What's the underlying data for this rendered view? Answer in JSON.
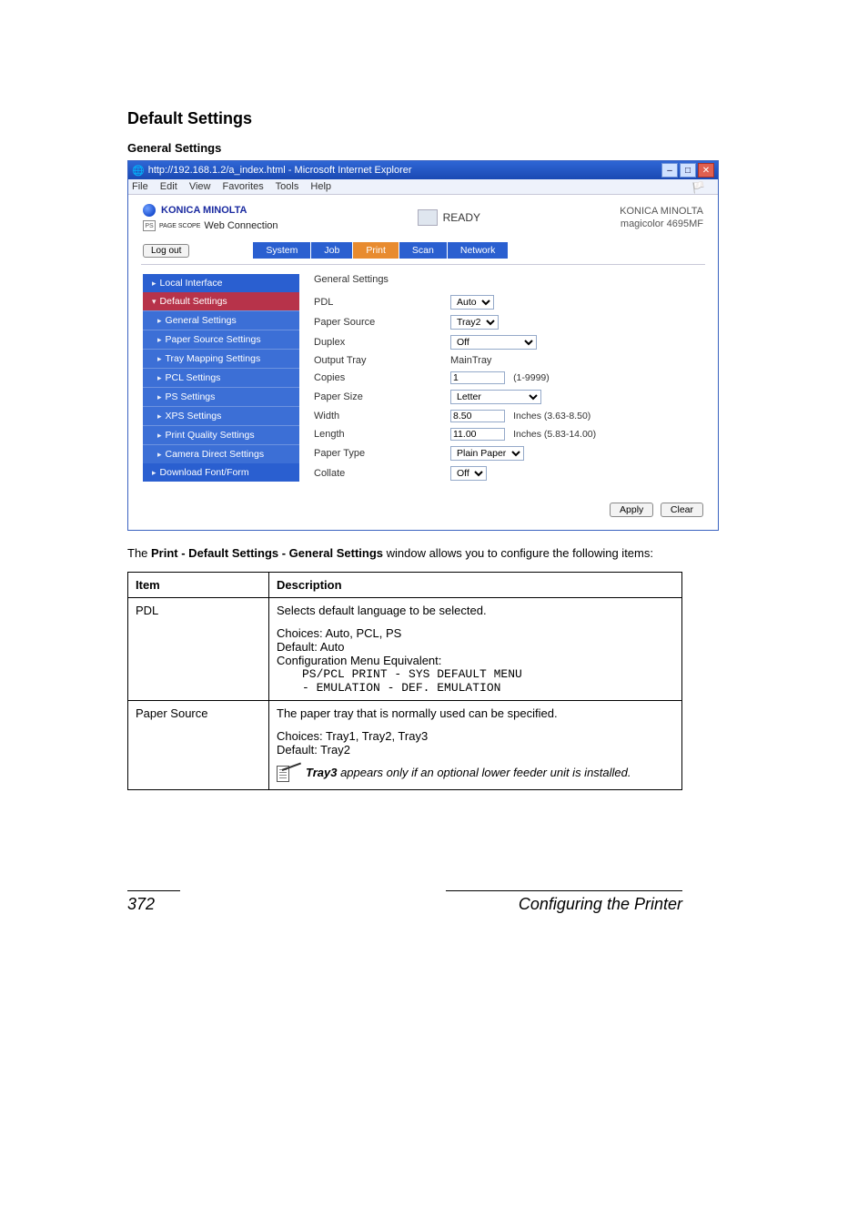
{
  "doc": {
    "section_title": "Default Settings",
    "subheading": "General Settings",
    "paragraph_prefix": "The ",
    "paragraph_bold": "Print - Default Settings - General Settings",
    "paragraph_suffix": " window allows you to configure the following items:",
    "footer_page": "372",
    "footer_text": "Configuring the Printer"
  },
  "win": {
    "title": "http://192.168.1.2/a_index.html - Microsoft Internet Explorer",
    "menu": {
      "file": "File",
      "edit": "Edit",
      "view": "View",
      "favorites": "Favorites",
      "tools": "Tools",
      "help": "Help"
    },
    "brand": "KONICA MINOLTA",
    "brand_sub": "Web Connection",
    "brand_sub_prefix": "PAGE SCOPE",
    "ready": "READY",
    "model_line1": "KONICA MINOLTA",
    "model_line2": "magicolor 4695MF",
    "logout": "Log out",
    "tabs": {
      "system": "System",
      "job": "Job",
      "print": "Print",
      "scan": "Scan",
      "network": "Network"
    }
  },
  "sidebar": {
    "local_interface": "Local Interface",
    "default_settings": "Default Settings",
    "general_settings": "General Settings",
    "paper_source_settings": "Paper Source Settings",
    "tray_mapping_settings": "Tray Mapping Settings",
    "pcl_settings": "PCL Settings",
    "ps_settings": "PS Settings",
    "xps_settings": "XPS Settings",
    "print_quality_settings": "Print Quality Settings",
    "camera_direct_settings": "Camera Direct Settings",
    "download_font_form": "Download Font/Form"
  },
  "form": {
    "title": "General Settings",
    "pdl": {
      "label": "PDL",
      "value": "Auto"
    },
    "paper_source": {
      "label": "Paper Source",
      "value": "Tray2"
    },
    "duplex": {
      "label": "Duplex",
      "value": "Off"
    },
    "output_tray": {
      "label": "Output Tray",
      "value": "MainTray"
    },
    "copies": {
      "label": "Copies",
      "value": "1",
      "hint": "(1-9999)"
    },
    "paper_size": {
      "label": "Paper Size",
      "value": "Letter"
    },
    "width": {
      "label": "Width",
      "value": "8.50",
      "unit": "Inches (3.63-8.50)"
    },
    "length": {
      "label": "Length",
      "value": "11.00",
      "unit": "Inches (5.83-14.00)"
    },
    "paper_type": {
      "label": "Paper Type",
      "value": "Plain Paper"
    },
    "collate": {
      "label": "Collate",
      "value": "Off"
    },
    "apply": "Apply",
    "clear": "Clear"
  },
  "table": {
    "h_item": "Item",
    "h_desc": "Description",
    "pdl": {
      "name": "PDL",
      "line1": "Selects default language to be selected.",
      "line2": "Choices: Auto, PCL, PS",
      "line3": "Default:  Auto",
      "line4": "Configuration Menu Equivalent:",
      "code1": "PS/PCL PRINT - SYS DEFAULT MENU",
      "code2": "- EMULATION - DEF. EMULATION"
    },
    "paper_source": {
      "name": "Paper Source",
      "line1": "The paper tray that is normally used can be specified.",
      "line2": "Choices: Tray1, Tray2, Tray3",
      "line3": "Default:  Tray2",
      "note_bold": "Tray3",
      "note_rest": " appears only if an optional lower feeder unit is installed."
    }
  }
}
